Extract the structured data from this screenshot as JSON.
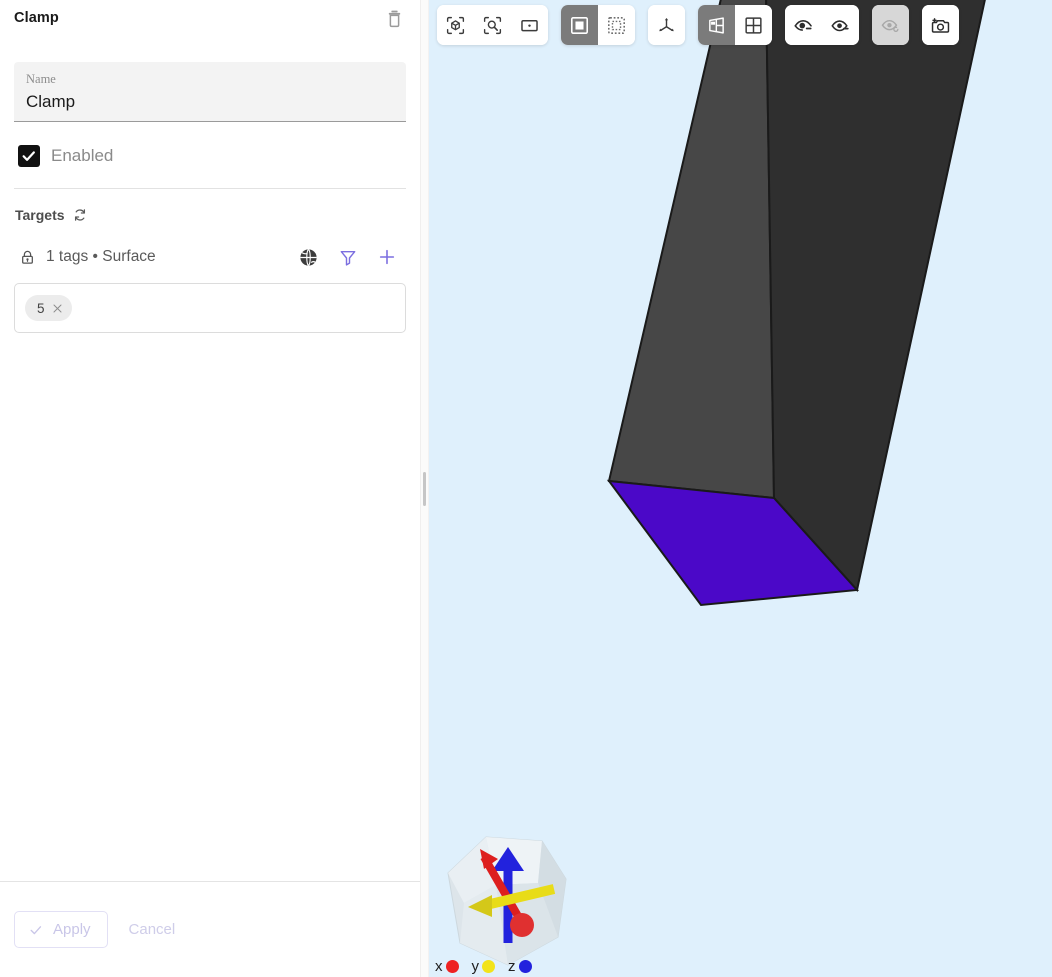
{
  "panel": {
    "title": "Clamp",
    "delete_icon": "trash-icon",
    "name_field": {
      "label": "Name",
      "value": "Clamp"
    },
    "enabled": {
      "label": "Enabled",
      "checked": true
    },
    "targets": {
      "section_title": "Targets",
      "sync_icon": "refresh-icon",
      "summary": "1 tags • Surface",
      "lock_icon": "lock-icon",
      "actions": [
        {
          "name": "globe-icon",
          "color": "#3c3c3c"
        },
        {
          "name": "filter-icon",
          "color": "#7c6fe0"
        },
        {
          "name": "plus-icon",
          "color": "#7c6fe0"
        }
      ],
      "chips": [
        {
          "label": "5",
          "remove_icon": "close-icon"
        }
      ]
    },
    "footer": {
      "apply_label": "Apply",
      "apply_icon": "check-icon",
      "apply_disabled": true,
      "cancel_label": "Cancel",
      "cancel_disabled": true
    }
  },
  "viewport": {
    "background_color": "#dff0fc",
    "toolbar": [
      {
        "group": "view-fit",
        "buttons": [
          {
            "name": "fit-to-object-icon",
            "active": false
          },
          {
            "name": "zoom-to-selection-icon",
            "active": false
          },
          {
            "name": "fit-to-window-icon",
            "active": false
          }
        ]
      },
      {
        "group": "selection-mode",
        "buttons": [
          {
            "name": "select-solid-icon",
            "active": true
          },
          {
            "name": "select-box-icon",
            "active": false
          }
        ]
      },
      {
        "group": "axes",
        "buttons": [
          {
            "name": "axes-triad-icon",
            "active": false
          }
        ]
      },
      {
        "group": "display-mode",
        "buttons": [
          {
            "name": "shaded-perspective-icon",
            "active": true
          },
          {
            "name": "grid-view-icon",
            "active": false
          }
        ]
      },
      {
        "group": "visibility",
        "buttons": [
          {
            "name": "hide-selected-icon",
            "active": false
          },
          {
            "name": "show-selected-icon",
            "active": false
          }
        ]
      },
      {
        "group": "reset-visibility",
        "dimmed": true,
        "buttons": [
          {
            "name": "reset-visibility-icon",
            "active": false
          }
        ]
      },
      {
        "group": "snapshot",
        "buttons": [
          {
            "name": "add-camera-icon",
            "active": false
          }
        ]
      }
    ],
    "gizmo": {
      "axes": [
        {
          "label": "x",
          "color": "#ee2222"
        },
        {
          "label": "y",
          "color": "#f2e31a"
        },
        {
          "label": "z",
          "color": "#2222dd"
        }
      ],
      "cube_color": "#d9e2e8"
    },
    "geometry": {
      "body_color_light": "#474747",
      "body_color_dark": "#2f2f2f",
      "selected_face_color": "#4b08c8",
      "edge_color": "#1a1a1a"
    }
  }
}
